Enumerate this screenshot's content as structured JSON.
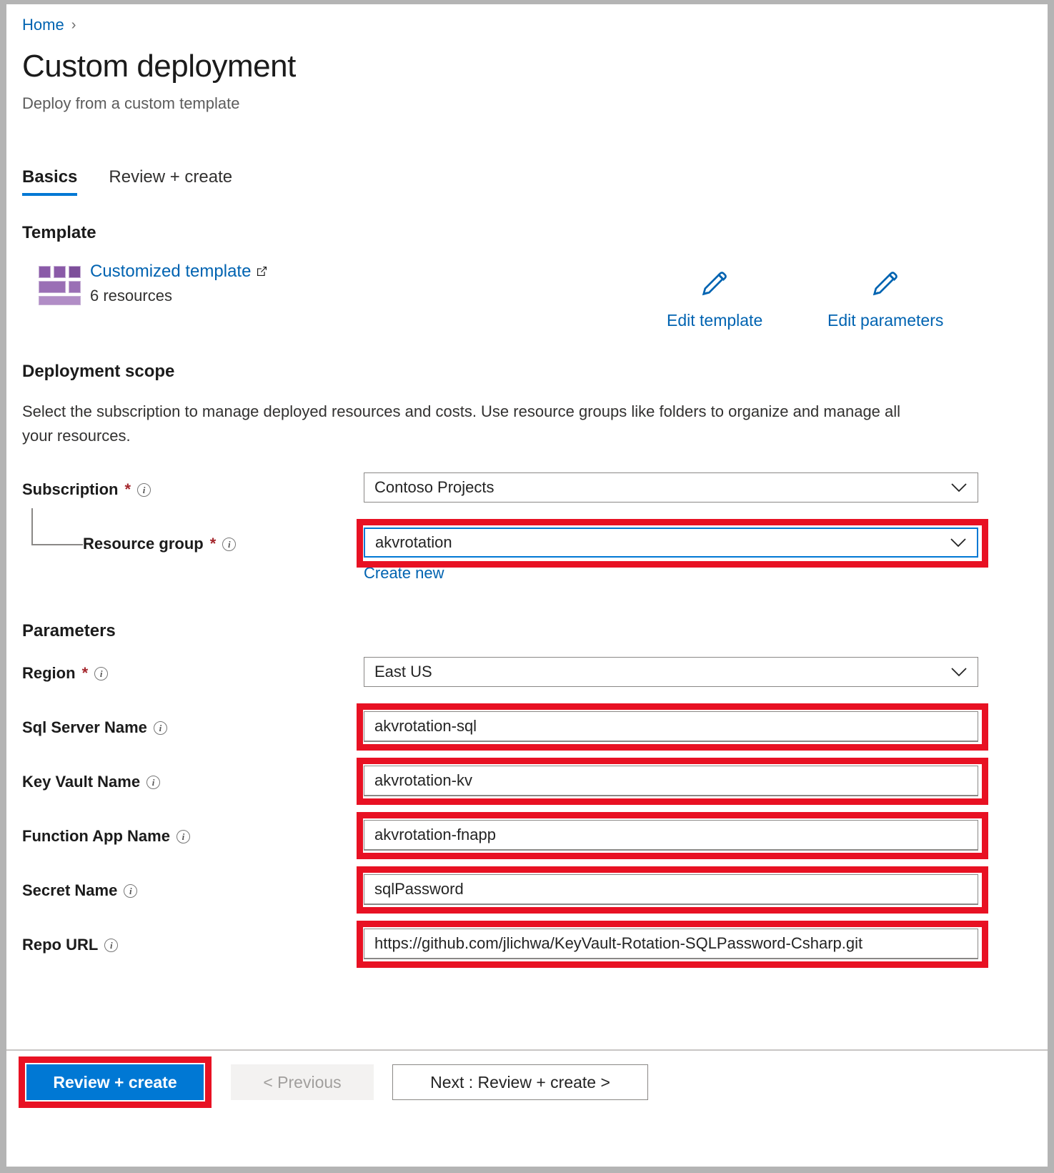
{
  "breadcrumb": {
    "home": "Home",
    "separator": "›"
  },
  "header": {
    "title": "Custom deployment",
    "subtitle": "Deploy from a custom template"
  },
  "tabs": [
    {
      "label": "Basics",
      "active": true
    },
    {
      "label": "Review + create",
      "active": false
    }
  ],
  "template_section": {
    "heading": "Template",
    "link_label": "Customized template",
    "external_link_icon": "external-link-icon",
    "resource_count": "6 resources",
    "template_icon": "template-grid-icon",
    "commands": [
      {
        "label": "Edit template",
        "icon": "pencil-icon"
      },
      {
        "label": "Edit parameters",
        "icon": "pencil-icon"
      }
    ]
  },
  "deployment_scope": {
    "heading": "Deployment scope",
    "description": "Select the subscription to manage deployed resources and costs. Use resource groups like folders to organize and manage all your resources.",
    "subscription": {
      "label": "Subscription",
      "required": "*",
      "info_icon": "info-icon",
      "value": "Contoso Projects",
      "chevron": "chevron-down-icon"
    },
    "resource_group": {
      "label": "Resource group",
      "required": "*",
      "info_icon": "info-icon",
      "value": "akvrotation",
      "chevron": "chevron-down-icon",
      "create_new_label": "Create new",
      "highlighted": true
    }
  },
  "parameters": {
    "heading": "Parameters",
    "fields": [
      {
        "label": "Region",
        "required": "*",
        "info_icon": "info-icon",
        "value": "East US",
        "type": "select",
        "highlighted": false
      },
      {
        "label": "Sql Server Name",
        "required": "",
        "info_icon": "info-icon",
        "value": "akvrotation-sql",
        "type": "text",
        "highlighted": true
      },
      {
        "label": "Key Vault Name",
        "required": "",
        "info_icon": "info-icon",
        "value": "akvrotation-kv",
        "type": "text",
        "highlighted": true
      },
      {
        "label": "Function App Name",
        "required": "",
        "info_icon": "info-icon",
        "value": "akvrotation-fnapp",
        "type": "text",
        "highlighted": true
      },
      {
        "label": "Secret Name",
        "required": "",
        "info_icon": "info-icon",
        "value": "sqlPassword",
        "type": "text",
        "highlighted": true
      },
      {
        "label": "Repo URL",
        "required": "",
        "info_icon": "info-icon",
        "value": "https://github.com/jlichwa/KeyVault-Rotation-SQLPassword-Csharp.git",
        "type": "text",
        "highlighted": true
      }
    ]
  },
  "footer": {
    "review_create": "Review + create",
    "previous": "< Previous",
    "next": "Next : Review + create >"
  },
  "colors": {
    "accent": "#0078d4",
    "link": "#0063b1",
    "annotation": "#e81123",
    "required": "#a4262c",
    "template_icon": "#8a5aa8"
  }
}
